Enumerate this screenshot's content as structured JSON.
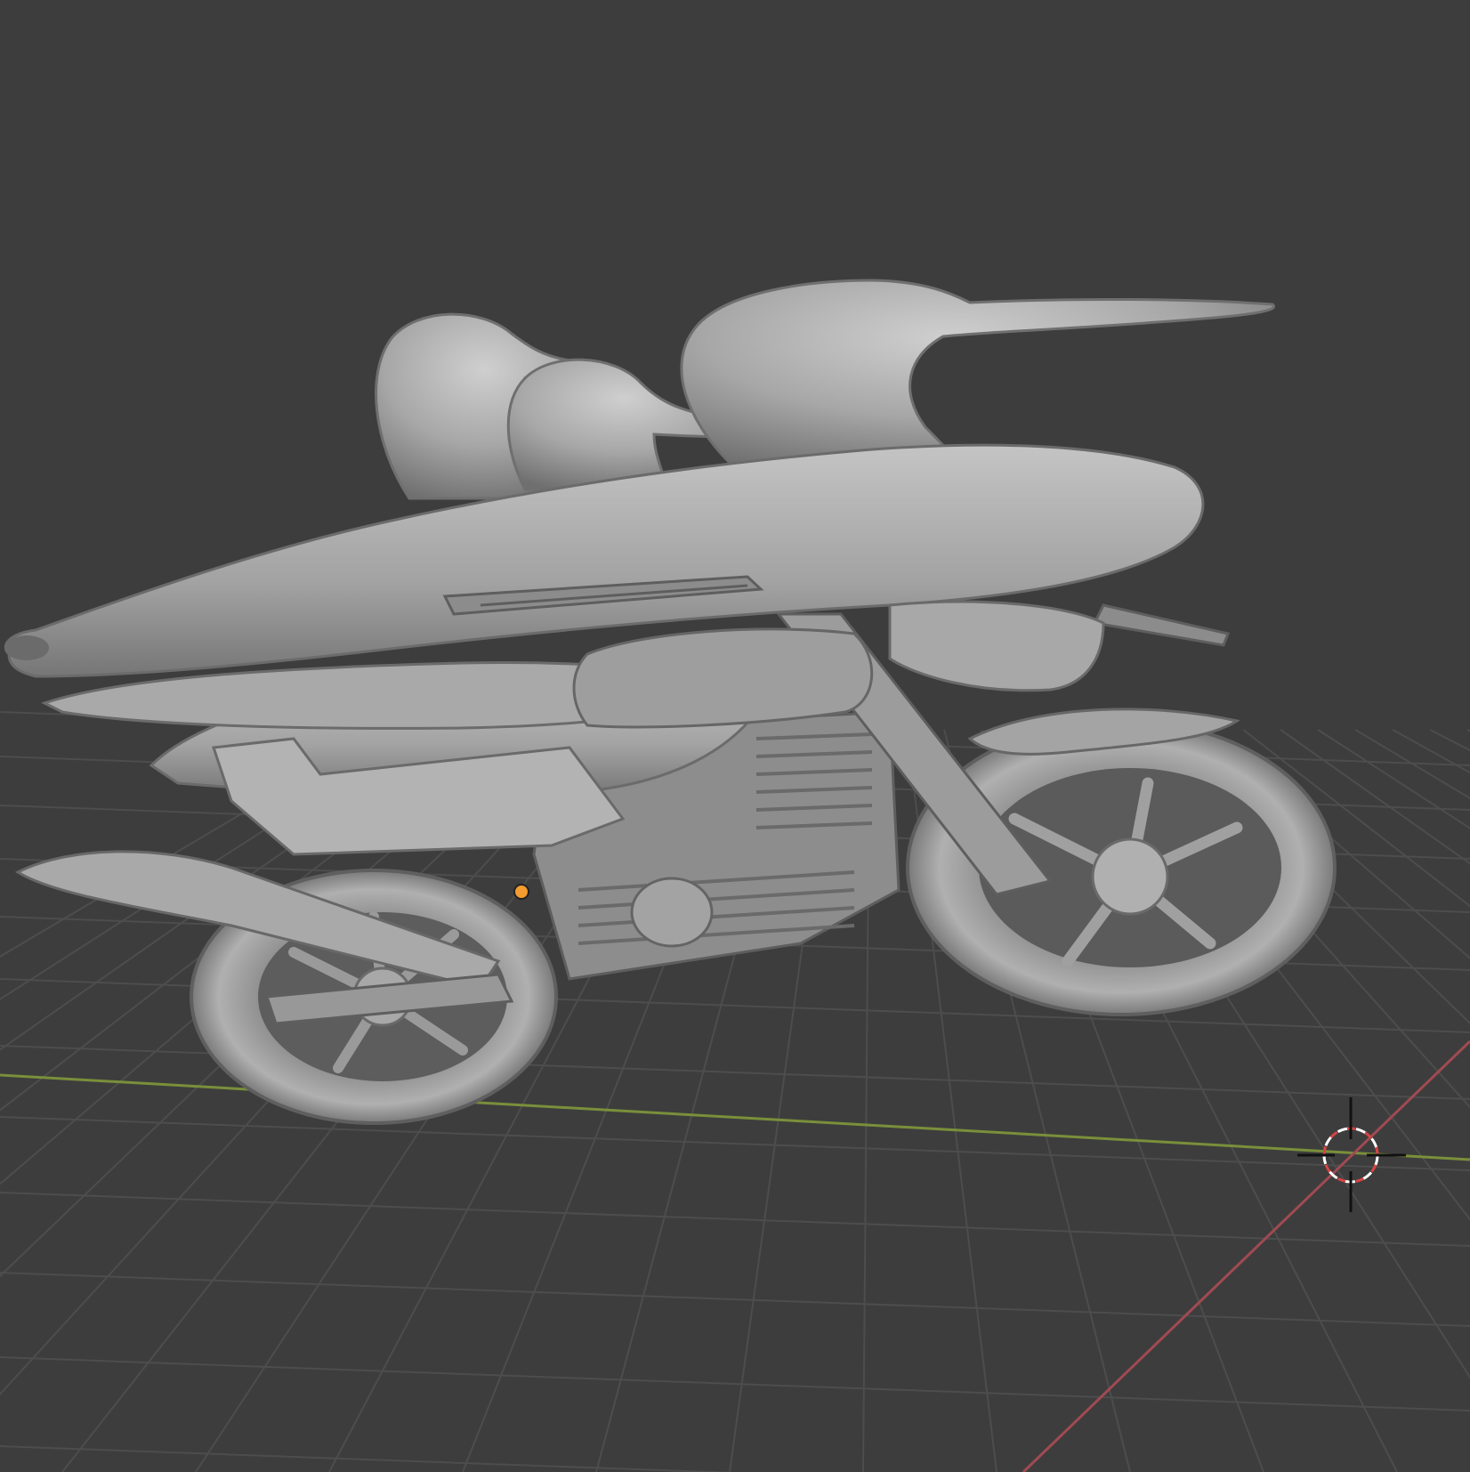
{
  "viewport": {
    "mode": "3D Viewport",
    "shading": "solid"
  },
  "colors": {
    "background": "#3d3d3d",
    "grid": "#4e4e4e",
    "x_axis": "#a04a52",
    "y_axis": "#7a8f3a",
    "mesh": "#a8a8a8",
    "origin": "#f39c2f"
  },
  "scene": {
    "objects": [
      "duck-motorcycle-mesh"
    ],
    "widgets": [
      "3d-cursor-icon",
      "object-origin-icon"
    ]
  }
}
